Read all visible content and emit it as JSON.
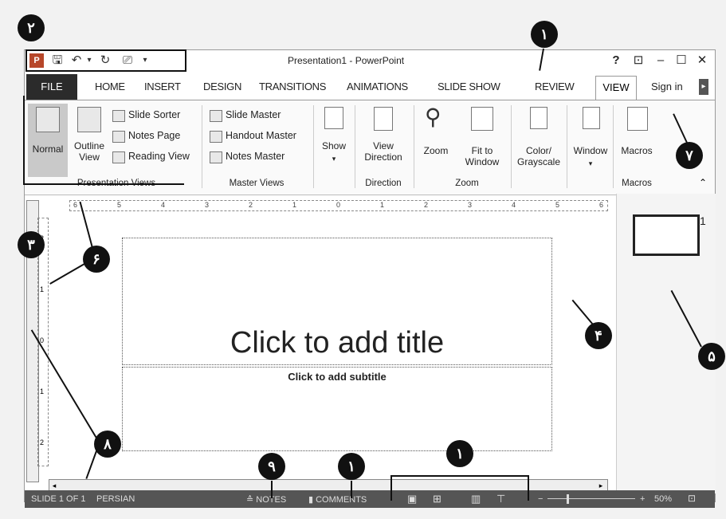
{
  "window": {
    "title": "Presentation1 - PowerPoint"
  },
  "qat": {
    "icons": [
      "powerpoint-logo-icon",
      "save-icon",
      "undo-icon",
      "redo-icon",
      "present-icon",
      "customize-icon"
    ]
  },
  "controls": {
    "help": "?",
    "ribbon_display": "⊡",
    "minimize": "–",
    "maximize": "☐",
    "close": "✕"
  },
  "tabs": {
    "file": "FILE",
    "items": [
      "HOME",
      "INSERT",
      "DESIGN",
      "TRANSITIONS",
      "ANIMATIONS",
      "SLIDE SHOW",
      "REVIEW"
    ],
    "active": "VIEW",
    "sign_in": "Sign in"
  },
  "ribbon": {
    "presentation_views": {
      "normal": "Normal",
      "outline": "Outline View",
      "slide_sorter": "Slide Sorter",
      "notes_page": "Notes Page",
      "reading_view": "Reading View",
      "label": "Presentation Views"
    },
    "master_views": {
      "slide_master": "Slide Master",
      "handout_master": "Handout Master",
      "notes_master": "Notes Master",
      "label": "Master Views"
    },
    "show": {
      "label": "Show"
    },
    "direction": {
      "view_direction": "View Direction",
      "label": "Direction"
    },
    "zoom": {
      "zoom": "Zoom",
      "fit": "Fit to Window",
      "label": "Zoom"
    },
    "color": {
      "label": "Color/ Grayscale"
    },
    "window": {
      "label": "Window"
    },
    "macros": {
      "macros": "Macros",
      "label": "Macros"
    }
  },
  "ruler": {
    "h_ticks": [
      "6",
      "5",
      "4",
      "3",
      "2",
      "1",
      "0",
      "1",
      "2",
      "3",
      "4",
      "5",
      "6"
    ],
    "v_ticks": [
      "2",
      "1",
      "0",
      "1",
      "2"
    ]
  },
  "slide": {
    "title_placeholder": "Click to add title",
    "subtitle_placeholder": "Click to add subtitle"
  },
  "thumbnail": {
    "number": "1"
  },
  "status": {
    "slide_info": "SLIDE 1 OF 1",
    "language": "PERSIAN",
    "notes": "NOTES",
    "comments": "COMMENTS",
    "zoom_level": "50%"
  },
  "callouts": [
    "۱",
    "۲",
    "۳",
    "۴",
    "۵",
    "۶",
    "۷",
    "۸",
    "۸",
    "۹",
    "۱",
    "۱"
  ]
}
